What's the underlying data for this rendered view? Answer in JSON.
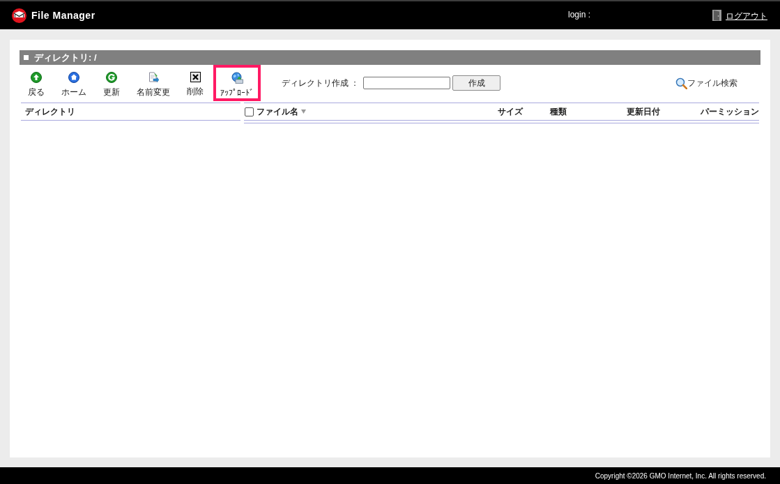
{
  "header": {
    "app_title": "File Manager",
    "login_label": "login :",
    "logout_link": "ログアウト"
  },
  "panel": {
    "title": "ディレクトリ: /"
  },
  "toolbar": [
    {
      "kind": "back",
      "label": "戻る",
      "highlighted": false
    },
    {
      "kind": "home",
      "label": "ホーム",
      "highlighted": false
    },
    {
      "kind": "refresh",
      "label": "更新",
      "highlighted": false
    },
    {
      "kind": "rename",
      "label": "名前変更",
      "highlighted": false
    },
    {
      "kind": "delete",
      "label": "削除",
      "highlighted": false
    },
    {
      "kind": "upload",
      "label": "ｱｯﾌﾟﾛｰﾄﾞ",
      "highlighted": true
    }
  ],
  "create_directory": {
    "label": "ディレクトリ作成 ：",
    "button": "作成"
  },
  "file_search": "ファイル検索",
  "directory_pane": {
    "heading": "ディレクトリ"
  },
  "file_table": {
    "select_all_checked": false,
    "columns": [
      {
        "label": "ファイル名",
        "sorted": true
      },
      {
        "label": "サイズ",
        "sorted": false
      },
      {
        "label": "種類",
        "sorted": false
      },
      {
        "label": "更新日付",
        "sorted": false
      },
      {
        "label": "パーミッション",
        "sorted": false
      }
    ]
  },
  "footer": "Copyright ©2026 GMO Internet, Inc. All rights reserved."
}
